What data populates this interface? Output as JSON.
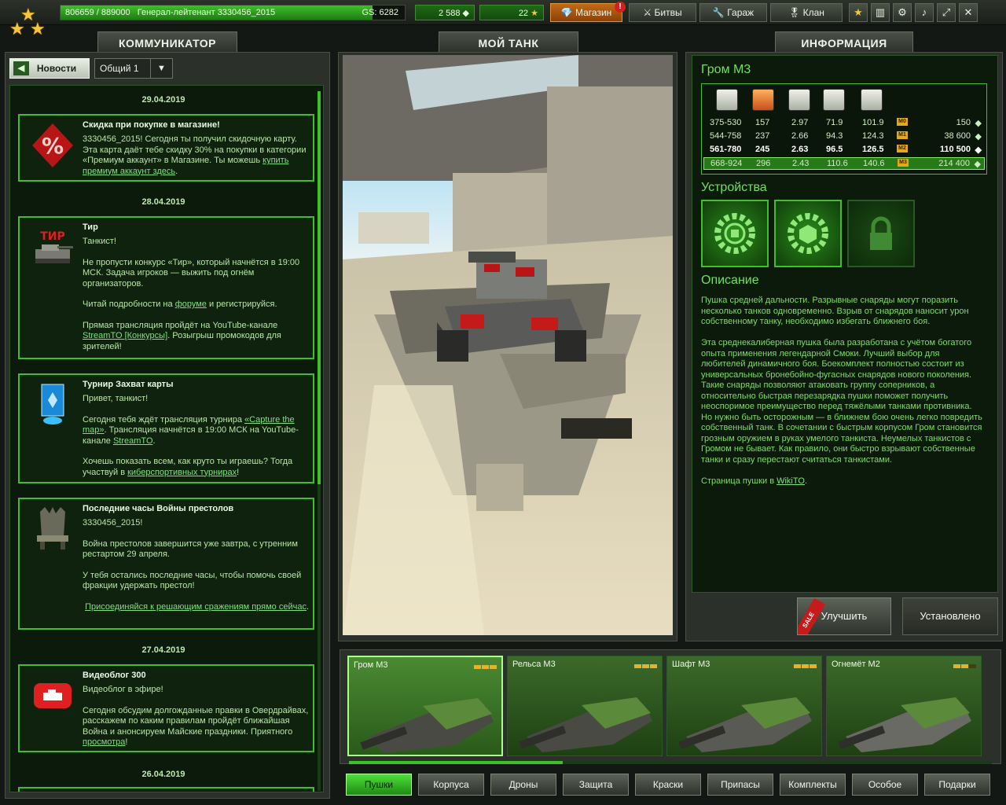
{
  "topbar": {
    "xp_text": "806659 / 889000",
    "rank_text": "Генерал-лейтенант 3330456_2015",
    "gs_text": "GS: 6282",
    "xp_fraction": 0.907,
    "crystals": "2 588",
    "stars": "22",
    "shop_label": "Магазин",
    "shop_badge": "!",
    "battles_label": "Битвы",
    "garage_label": "Гараж",
    "clan_label": "Клан",
    "icons": [
      "star-icon",
      "stats-icon",
      "settings-icon",
      "sound-icon",
      "fullscreen-icon",
      "close-icon"
    ]
  },
  "panels": {
    "communicator": "КОММУНИКАТОР",
    "my_tank": "МОЙ ТАНК",
    "info": "ИНФОРМАЦИЯ"
  },
  "communicator": {
    "news_label": "Новости",
    "channel": "Общий 1",
    "items": [
      {
        "date": "29.04.2019",
        "title": "Скидка при покупке в магазине!",
        "paragraphs": [
          "3330456_2015! Сегодня ты получил скидочную карту. Эта карта даёт тебе скидку 30% на покупки в категории «Премиум аккаунт» в Магазине. Ты можешь"
        ],
        "link": "купить премиум аккаунт здесь",
        "tail": "."
      },
      {
        "date": "28.04.2019",
        "title": "Тир",
        "p1": "Танкист!",
        "p2": "Не пропусти конкурс «Тир», который начнётся в 19:00 МСК. Задача игроков — выжить под огнём организаторов.",
        "p3a": "Читай подробности на ",
        "p3link": "форуме",
        "p3b": " и регистрируйся.",
        "p4a": "Прямая трансляция пройдёт на YouTube-канале ",
        "p4link": "StreamTO [Конкурсы]",
        "p4b": ". Розыгрыш промокодов для зрителей!",
        "pic_label": "ТИР"
      },
      {
        "title": "Турнир Захват карты",
        "p1": "Привет, танкист!",
        "p2a": " Сегодня тебя ждёт трансляция турнира ",
        "p2link": "«Capture the map»",
        "p2b": ". Трансляция начнётся в 19:00 МСК на YouTube-канале ",
        "p2link2": "StreamTO",
        "p2c": ".",
        "p3a": "Хочешь показать всем, как круто ты играешь? Тогда участвуй в ",
        "p3link": "киберспортивных турнирах",
        "p3b": "!"
      },
      {
        "title": "Последние часы Войны престолов",
        "p1": "3330456_2015!",
        "p2": "Война престолов завершится уже завтра, с утренним рестартом 29 апреля.",
        "p3": "У тебя остались последние часы, чтобы помочь своей фракции удержать престол!",
        "p4link": "Присоединяйся к решающим сражениям прямо сейчас",
        "p4b": "."
      },
      {
        "date": "27.04.2019",
        "title": "Видеоблог 300",
        "p1": "Видеоблог в эфире!",
        "p2a": "Сегодня обсудим долгожданные правки в Овердрайвах, расскажем по каким правилам пройдёт ближайшая Война и анонсируем Майские праздники. Приятного ",
        "p2link": "просмотра",
        "p2b": "!"
      },
      {
        "date": "26.04.2019"
      }
    ]
  },
  "info": {
    "item_name": "Гром М3",
    "stat_icons": [
      "damage-icon",
      "impact-force-icon",
      "reload-icon",
      "range-icon",
      "splash-radius-icon"
    ],
    "rows": [
      {
        "dmg": "375-530",
        "imp": "157",
        "rel": "2.97",
        "rng": "71.9",
        "rad": "101.9",
        "mk": "M0",
        "price": "150"
      },
      {
        "dmg": "544-758",
        "imp": "237",
        "rel": "2.66",
        "rng": "94.3",
        "rad": "124.3",
        "mk": "M1",
        "price": "38 600"
      },
      {
        "dmg": "561-780",
        "imp": "245",
        "rel": "2.63",
        "rng": "96.5",
        "rad": "126.5",
        "mk": "M2",
        "price": "110 500"
      },
      {
        "dmg": "668-924",
        "imp": "296",
        "rel": "2.43",
        "rng": "110.6",
        "rad": "140.6",
        "mk": "M3",
        "price": "214 400"
      }
    ],
    "devices_title": "Устройства",
    "description_title": "Описание",
    "desc_p1": "Пушка средней дальности. Разрывные снаряды могут поразить несколько танков одновременно. Взрыв от снарядов наносит урон собственному танку, необходимо избегать ближнего боя.",
    "desc_p2": "Эта среднекалиберная пушка была разработана с учётом богатого опыта применения легендарной Смоки. Лучший выбор для любителей динамичного боя. Боекомплект полностью состоит из универсальных бронебойно-фугасных снарядов нового поколения. Такие снаряды позволяют атаковать группу соперников, а относительно быстрая перезарядка пушки поможет получить неоспоримое преимущество перед тяжёлыми танками противника. Но нужно быть осторожным — в ближнем бою очень легко повредить собственный танк. В сочетании с быстрым корпусом Гром становится грозным оружием в руках умелого танкиста. Неумелых танкистов с Громом не бывает. Как правило, они быстро взрывают собственные танки и сразу перестают считаться танкистами.",
    "desc_p3a": "Страница пушки в ",
    "desc_p3link": "WikiTO",
    "desc_p3b": ".",
    "upgrade_label": "Улучшить",
    "sale_label": "SALE",
    "installed_label": "Установлено"
  },
  "garage": {
    "slots": [
      {
        "name": "Гром M3",
        "pips": 3
      },
      {
        "name": "Рельса M3",
        "pips": 3
      },
      {
        "name": "Шафт M3",
        "pips": 3
      },
      {
        "name": "Огнемёт M2",
        "pips": 2
      }
    ],
    "categories": [
      "Пушки",
      "Корпуса",
      "Дроны",
      "Защита",
      "Краски",
      "Припасы",
      "Комплекты",
      "Особое",
      "Подарки"
    ]
  },
  "colors": {
    "accent": "#3fbf2a",
    "link": "#7fe07f",
    "shop": "#c06a18"
  }
}
